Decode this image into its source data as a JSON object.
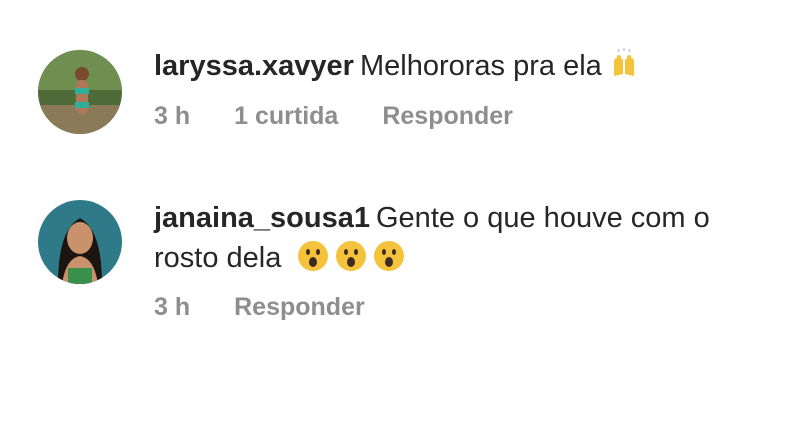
{
  "comments": [
    {
      "username": "laryssa.xavyer",
      "text": "Melhororas pra ela",
      "emoji": "raised-hands-icon",
      "time": "3 h",
      "likes": "1 curtida",
      "reply": "Responder"
    },
    {
      "username": "janaina_sousa1",
      "text_line1": "Gente o que houve com o",
      "text_line2": "rosto dela",
      "emoji": "astonished-face-icon",
      "time": "3 h",
      "reply": "Responder"
    }
  ],
  "colors": {
    "text": "#262626",
    "meta": "#8e8e8e",
    "emoji_yellow": "#f5c33b"
  }
}
